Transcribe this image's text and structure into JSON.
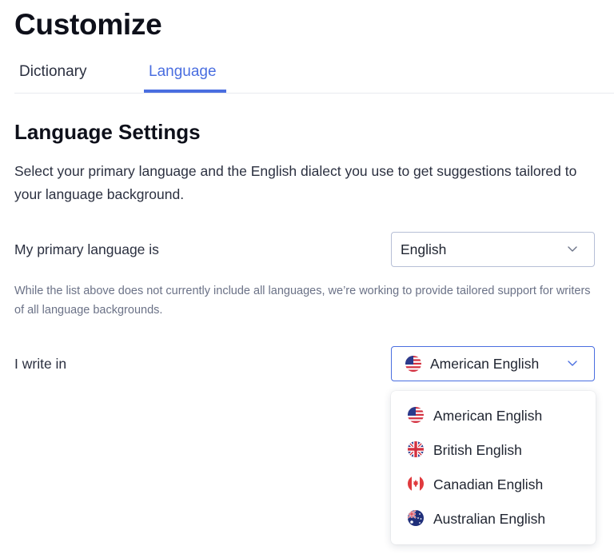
{
  "page": {
    "title": "Customize"
  },
  "tabs": [
    {
      "label": "Dictionary",
      "active": false
    },
    {
      "label": "Language",
      "active": true
    }
  ],
  "section": {
    "title": "Language Settings",
    "description": "Select your primary language and the English dialect you use to get suggestions tailored to your language background."
  },
  "primary_language": {
    "label": "My primary language is",
    "selected": "English",
    "note": "While the list above does not currently include all languages, we’re working to provide tailored support for writers of all language backgrounds."
  },
  "dialect": {
    "label": "I write in",
    "selected": "American English",
    "selected_flag": "us-flag-icon",
    "options": [
      {
        "label": "American English",
        "icon": "us-flag-icon"
      },
      {
        "label": "British English",
        "icon": "uk-flag-icon"
      },
      {
        "label": "Canadian English",
        "icon": "canada-flag-icon"
      },
      {
        "label": "Australian English",
        "icon": "australia-flag-icon"
      }
    ]
  },
  "colors": {
    "accent": "#4a6ee0",
    "text": "#1f2430",
    "muted": "#6b7287"
  }
}
